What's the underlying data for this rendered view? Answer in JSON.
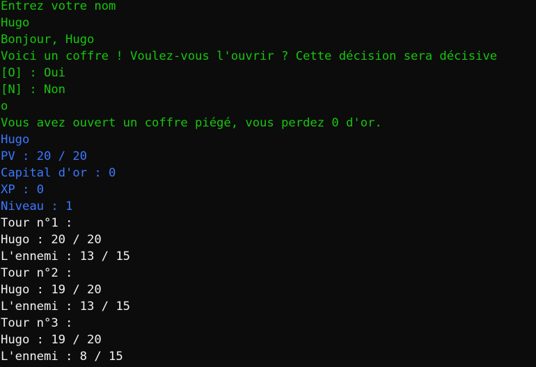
{
  "colors": {
    "background": "#0c0c0c",
    "green": "#16c60c",
    "blue": "#3b78ff",
    "white": "#f2f2f2"
  },
  "lines": [
    {
      "text": "Entrez votre nom",
      "color": "green"
    },
    {
      "text": "Hugo",
      "color": "green"
    },
    {
      "text": "Bonjour, Hugo",
      "color": "green"
    },
    {
      "text": "Voici un coffre ! Voulez-vous l'ouvrir ? Cette décision sera décisive",
      "color": "green"
    },
    {
      "text": "[O] : Oui",
      "color": "green"
    },
    {
      "text": "[N] : Non",
      "color": "green"
    },
    {
      "text": "o",
      "color": "green"
    },
    {
      "text": "Vous avez ouvert un coffre piégé, vous perdez 0 d'or.",
      "color": "green"
    },
    {
      "text": "Hugo",
      "color": "blue"
    },
    {
      "text": "PV : 20 / 20",
      "color": "blue"
    },
    {
      "text": "Capital d'or : 0",
      "color": "blue"
    },
    {
      "text": "XP : 0",
      "color": "blue"
    },
    {
      "text": "Niveau : 1",
      "color": "blue"
    },
    {
      "text": "Tour n°1 :",
      "color": "white"
    },
    {
      "text": "Hugo : 20 / 20",
      "color": "white"
    },
    {
      "text": "L'ennemi : 13 / 15",
      "color": "white"
    },
    {
      "text": "Tour n°2 :",
      "color": "white"
    },
    {
      "text": "Hugo : 19 / 20",
      "color": "white"
    },
    {
      "text": "L'ennemi : 13 / 15",
      "color": "white"
    },
    {
      "text": "Tour n°3 :",
      "color": "white"
    },
    {
      "text": "Hugo : 19 / 20",
      "color": "white"
    },
    {
      "text": "L'ennemi : 8 / 15",
      "color": "white"
    }
  ]
}
